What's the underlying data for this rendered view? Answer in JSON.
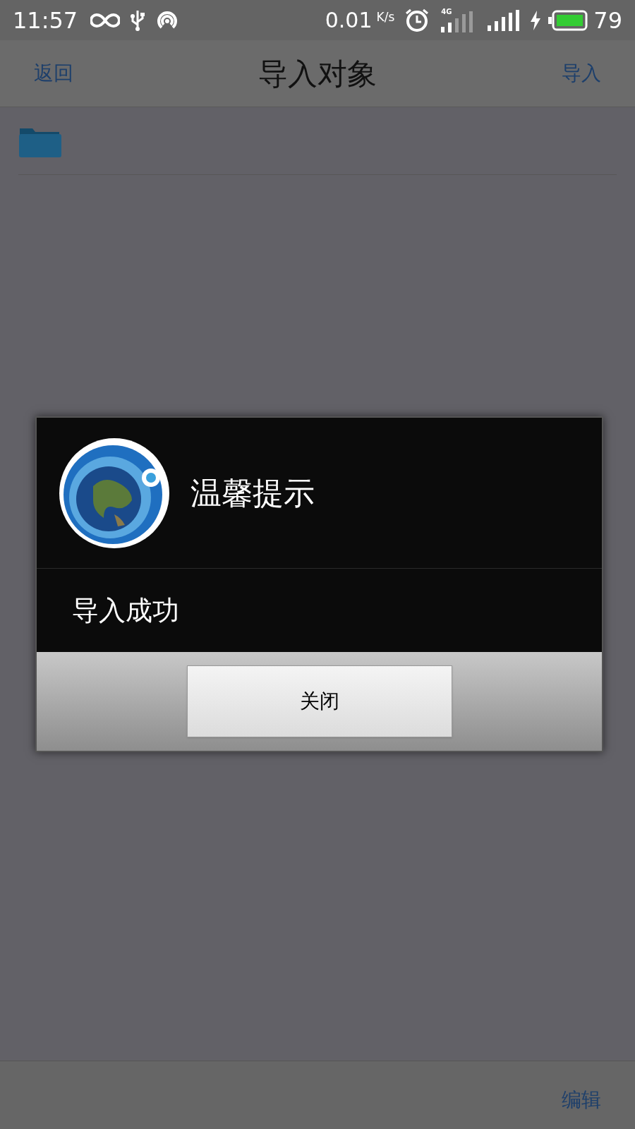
{
  "status_bar": {
    "time": "11:57",
    "speed": "0.01",
    "speed_unit": "K/s",
    "network": "4G",
    "battery": "79"
  },
  "nav_bar": {
    "back": "返回",
    "title": "导入对象",
    "action": "导入"
  },
  "list": [
    {
      "kind": "folder"
    }
  ],
  "dialog": {
    "title": "温馨提示",
    "message": "导入成功",
    "button": "关闭"
  },
  "bottom_bar": {
    "action": "编辑"
  }
}
